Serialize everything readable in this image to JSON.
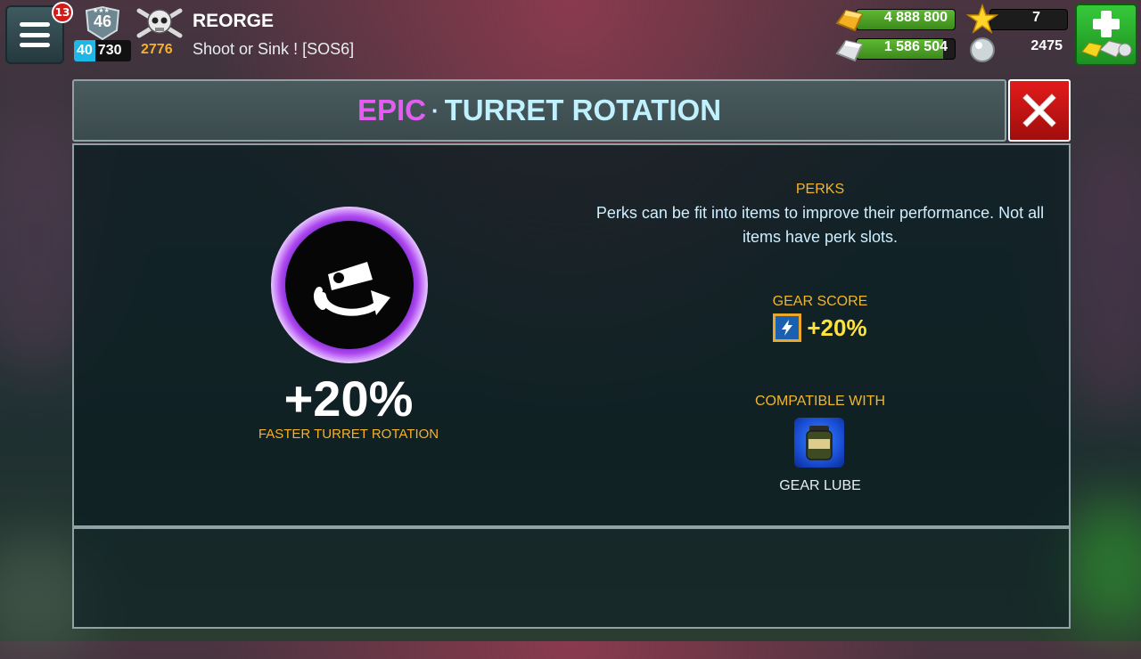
{
  "hud": {
    "notification_count": "13",
    "level": "46",
    "xp_level": "40",
    "xp_value": "730",
    "skull_score": "2776",
    "player_name": "REORGE",
    "clan_name": "Shoot or Sink ! [SOS6]",
    "gold": "4 888 800",
    "silver": "1 586 504",
    "stars": "7",
    "pearls": "2475",
    "icons": {
      "menu": "hamburger-menu-icon",
      "level": "shield-icon",
      "skull": "skull-crossbones-icon",
      "gold": "gold-bar-icon",
      "silver": "silver-bar-icon",
      "star": "star-icon",
      "pearl": "pearl-icon",
      "store": "plus-store-icon"
    }
  },
  "dialog": {
    "rarity": "EPIC",
    "separator": "·",
    "title": "TURRET ROTATION",
    "close_icon": "close-x-icon",
    "perk": {
      "icon": "turret-rotation-icon",
      "value": "+20%",
      "effect": "FASTER TURRET ROTATION"
    },
    "perks_section": {
      "label": "PERKS",
      "description": "Perks can be fit into items to improve their performance. Not all items have perk slots."
    },
    "gear_score": {
      "label": "GEAR SCORE",
      "icon": "gear-score-icon",
      "value": "+20%"
    },
    "compatible": {
      "label": "COMPATIBLE WITH",
      "item_icon": "gear-lube-jar-icon",
      "item_name": "GEAR LUBE"
    }
  },
  "colors": {
    "rarity_epic": "#e35ef0",
    "title": "#bff1ff",
    "label_gold": "#f0b52e",
    "gear_value": "#ffe23a",
    "close_red": "#e21b1b",
    "store_green": "#37c93a"
  }
}
